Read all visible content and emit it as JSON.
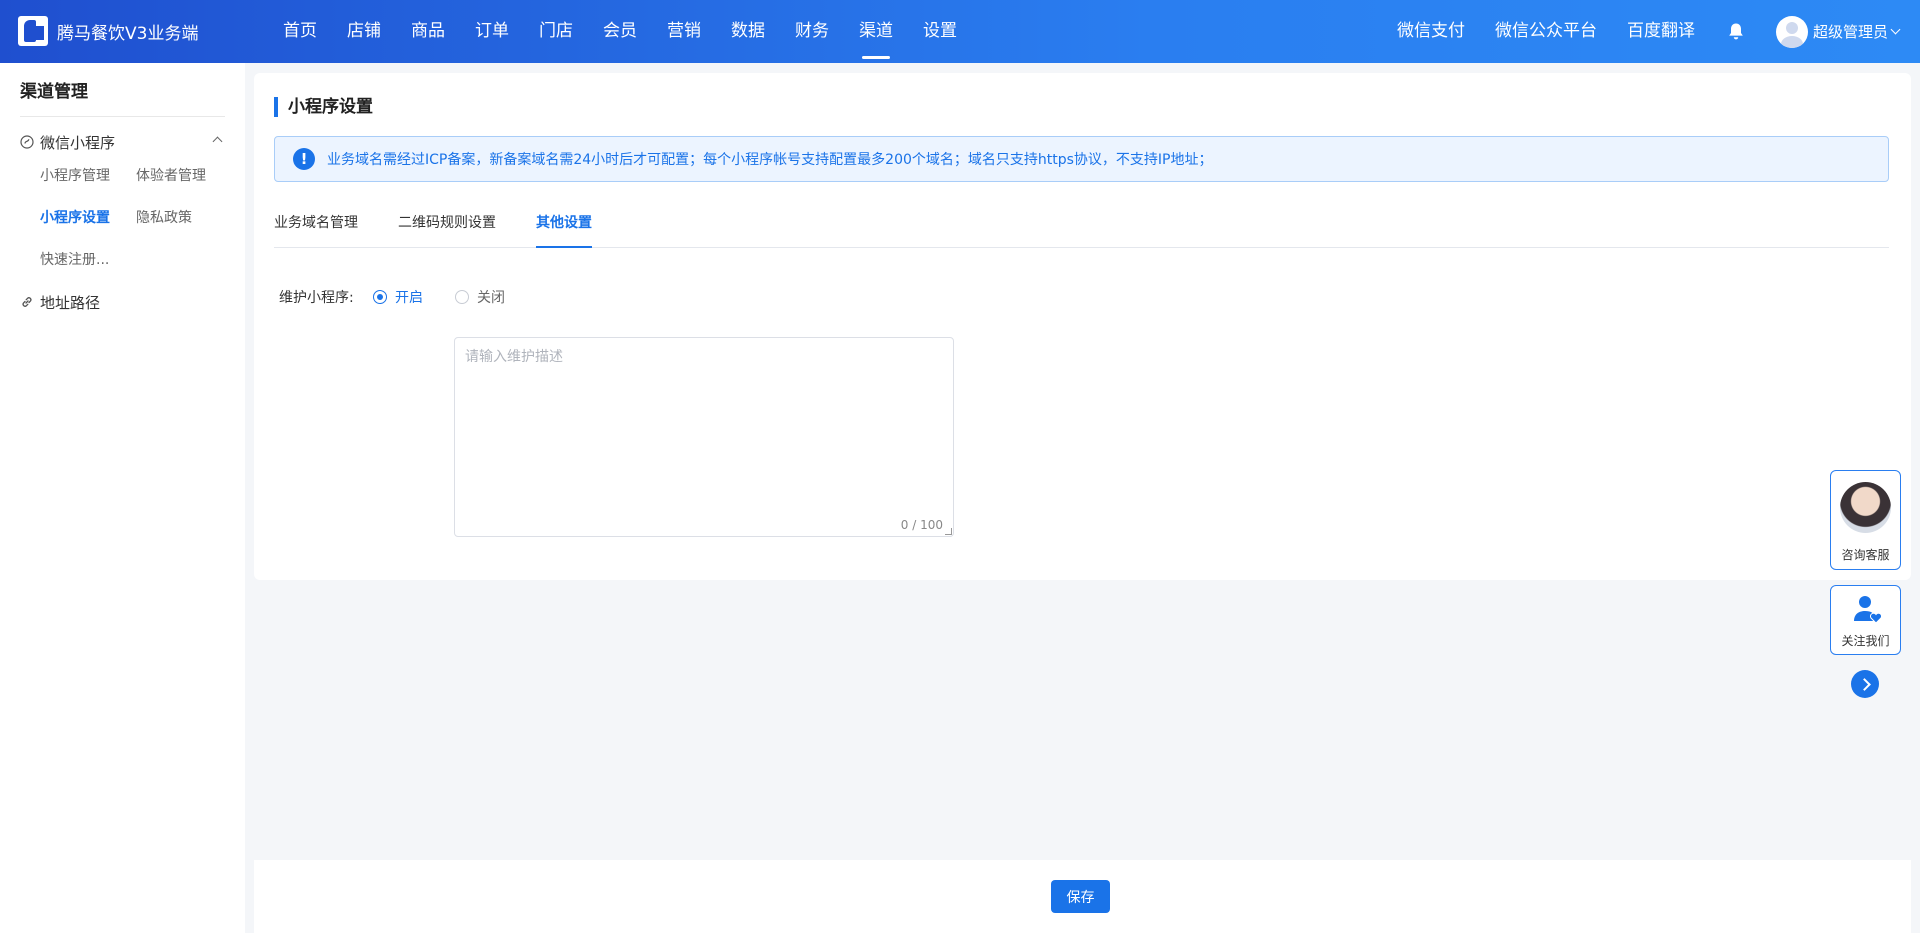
{
  "brand": {
    "name": "腾马餐饮V3业务端"
  },
  "nav": {
    "items": [
      "首页",
      "店铺",
      "商品",
      "订单",
      "门店",
      "会员",
      "营销",
      "数据",
      "财务",
      "渠道",
      "设置"
    ],
    "active": "渠道"
  },
  "toplinks": [
    "微信支付",
    "微信公众平台",
    "百度翻译"
  ],
  "user": {
    "name": "超级管理员"
  },
  "sidebar": {
    "title": "渠道管理",
    "group1": {
      "label": "微信小程序",
      "items": [
        "小程序管理",
        "体验者管理",
        "小程序设置",
        "隐私政策",
        "快速注册..."
      ],
      "active": "小程序设置"
    },
    "group2": {
      "label": "地址路径"
    }
  },
  "page": {
    "title": "小程序设置",
    "alert": "业务域名需经过ICP备案，新备案域名需24小时后才可配置；每个小程序帐号支持配置最多200个域名；域名只支持https协议，不支持IP地址；",
    "tabs": [
      "业务域名管理",
      "二维码规则设置",
      "其他设置"
    ],
    "active_tab": "其他设置",
    "form": {
      "label": "维护小程序:",
      "options": [
        "开启",
        "关闭"
      ],
      "selected": "开启",
      "textarea": {
        "placeholder": "请输入维护描述",
        "value": "",
        "counter": "0 / 100"
      }
    }
  },
  "float": {
    "consult": "咨询客服",
    "follow": "关注我们"
  },
  "footer": {
    "save": "保存"
  },
  "colors": {
    "primary": "#1a73e8",
    "topbar_start": "#1f4fcf",
    "topbar_end": "#2d8af5"
  }
}
